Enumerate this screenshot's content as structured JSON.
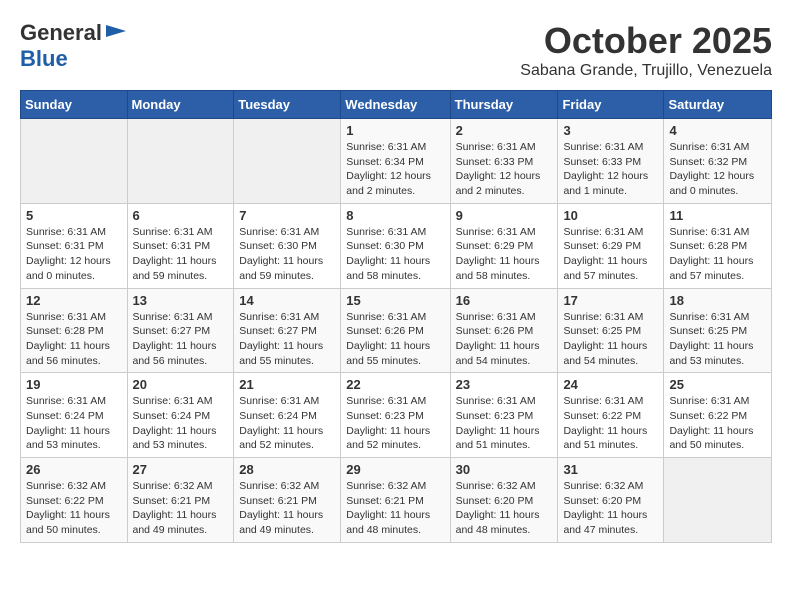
{
  "header": {
    "logo_line1": "General",
    "logo_line2": "Blue",
    "month": "October 2025",
    "location": "Sabana Grande, Trujillo, Venezuela"
  },
  "weekdays": [
    "Sunday",
    "Monday",
    "Tuesday",
    "Wednesday",
    "Thursday",
    "Friday",
    "Saturday"
  ],
  "weeks": [
    [
      {
        "day": "",
        "info": ""
      },
      {
        "day": "",
        "info": ""
      },
      {
        "day": "",
        "info": ""
      },
      {
        "day": "1",
        "info": "Sunrise: 6:31 AM\nSunset: 6:34 PM\nDaylight: 12 hours\nand 2 minutes."
      },
      {
        "day": "2",
        "info": "Sunrise: 6:31 AM\nSunset: 6:33 PM\nDaylight: 12 hours\nand 2 minutes."
      },
      {
        "day": "3",
        "info": "Sunrise: 6:31 AM\nSunset: 6:33 PM\nDaylight: 12 hours\nand 1 minute."
      },
      {
        "day": "4",
        "info": "Sunrise: 6:31 AM\nSunset: 6:32 PM\nDaylight: 12 hours\nand 0 minutes."
      }
    ],
    [
      {
        "day": "5",
        "info": "Sunrise: 6:31 AM\nSunset: 6:31 PM\nDaylight: 12 hours\nand 0 minutes."
      },
      {
        "day": "6",
        "info": "Sunrise: 6:31 AM\nSunset: 6:31 PM\nDaylight: 11 hours\nand 59 minutes."
      },
      {
        "day": "7",
        "info": "Sunrise: 6:31 AM\nSunset: 6:30 PM\nDaylight: 11 hours\nand 59 minutes."
      },
      {
        "day": "8",
        "info": "Sunrise: 6:31 AM\nSunset: 6:30 PM\nDaylight: 11 hours\nand 58 minutes."
      },
      {
        "day": "9",
        "info": "Sunrise: 6:31 AM\nSunset: 6:29 PM\nDaylight: 11 hours\nand 58 minutes."
      },
      {
        "day": "10",
        "info": "Sunrise: 6:31 AM\nSunset: 6:29 PM\nDaylight: 11 hours\nand 57 minutes."
      },
      {
        "day": "11",
        "info": "Sunrise: 6:31 AM\nSunset: 6:28 PM\nDaylight: 11 hours\nand 57 minutes."
      }
    ],
    [
      {
        "day": "12",
        "info": "Sunrise: 6:31 AM\nSunset: 6:28 PM\nDaylight: 11 hours\nand 56 minutes."
      },
      {
        "day": "13",
        "info": "Sunrise: 6:31 AM\nSunset: 6:27 PM\nDaylight: 11 hours\nand 56 minutes."
      },
      {
        "day": "14",
        "info": "Sunrise: 6:31 AM\nSunset: 6:27 PM\nDaylight: 11 hours\nand 55 minutes."
      },
      {
        "day": "15",
        "info": "Sunrise: 6:31 AM\nSunset: 6:26 PM\nDaylight: 11 hours\nand 55 minutes."
      },
      {
        "day": "16",
        "info": "Sunrise: 6:31 AM\nSunset: 6:26 PM\nDaylight: 11 hours\nand 54 minutes."
      },
      {
        "day": "17",
        "info": "Sunrise: 6:31 AM\nSunset: 6:25 PM\nDaylight: 11 hours\nand 54 minutes."
      },
      {
        "day": "18",
        "info": "Sunrise: 6:31 AM\nSunset: 6:25 PM\nDaylight: 11 hours\nand 53 minutes."
      }
    ],
    [
      {
        "day": "19",
        "info": "Sunrise: 6:31 AM\nSunset: 6:24 PM\nDaylight: 11 hours\nand 53 minutes."
      },
      {
        "day": "20",
        "info": "Sunrise: 6:31 AM\nSunset: 6:24 PM\nDaylight: 11 hours\nand 53 minutes."
      },
      {
        "day": "21",
        "info": "Sunrise: 6:31 AM\nSunset: 6:24 PM\nDaylight: 11 hours\nand 52 minutes."
      },
      {
        "day": "22",
        "info": "Sunrise: 6:31 AM\nSunset: 6:23 PM\nDaylight: 11 hours\nand 52 minutes."
      },
      {
        "day": "23",
        "info": "Sunrise: 6:31 AM\nSunset: 6:23 PM\nDaylight: 11 hours\nand 51 minutes."
      },
      {
        "day": "24",
        "info": "Sunrise: 6:31 AM\nSunset: 6:22 PM\nDaylight: 11 hours\nand 51 minutes."
      },
      {
        "day": "25",
        "info": "Sunrise: 6:31 AM\nSunset: 6:22 PM\nDaylight: 11 hours\nand 50 minutes."
      }
    ],
    [
      {
        "day": "26",
        "info": "Sunrise: 6:32 AM\nSunset: 6:22 PM\nDaylight: 11 hours\nand 50 minutes."
      },
      {
        "day": "27",
        "info": "Sunrise: 6:32 AM\nSunset: 6:21 PM\nDaylight: 11 hours\nand 49 minutes."
      },
      {
        "day": "28",
        "info": "Sunrise: 6:32 AM\nSunset: 6:21 PM\nDaylight: 11 hours\nand 49 minutes."
      },
      {
        "day": "29",
        "info": "Sunrise: 6:32 AM\nSunset: 6:21 PM\nDaylight: 11 hours\nand 48 minutes."
      },
      {
        "day": "30",
        "info": "Sunrise: 6:32 AM\nSunset: 6:20 PM\nDaylight: 11 hours\nand 48 minutes."
      },
      {
        "day": "31",
        "info": "Sunrise: 6:32 AM\nSunset: 6:20 PM\nDaylight: 11 hours\nand 47 minutes."
      },
      {
        "day": "",
        "info": ""
      }
    ]
  ]
}
